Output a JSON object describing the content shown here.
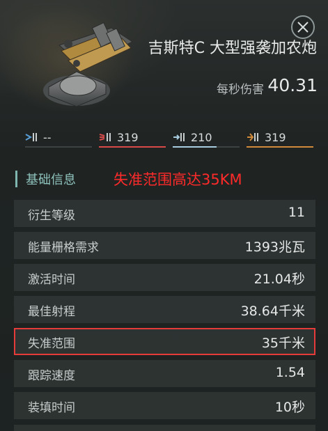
{
  "header": {
    "weapon_name": "吉斯特C 大型强袭加农炮",
    "dps_label": "每秒伤害",
    "dps_value": "40.31"
  },
  "damage": [
    {
      "name": "em",
      "icon": "em-damage-icon",
      "value": "--",
      "color": "#5aa0d8",
      "fill": 0
    },
    {
      "name": "thermal",
      "icon": "thermal-damage-icon",
      "value": "319",
      "color": "#d84a4a",
      "fill": 1.0
    },
    {
      "name": "kinetic",
      "icon": "kinetic-damage-icon",
      "value": "210",
      "color": "#a9cde0",
      "fill": 0.66
    },
    {
      "name": "explosive",
      "icon": "explosive-damage-icon",
      "value": "319",
      "color": "#d08a3a",
      "fill": 1.0
    }
  ],
  "section": {
    "title": "基础信息",
    "annotation": "失准范围高达35KM"
  },
  "stats": [
    {
      "label": "衍生等级",
      "value": "11",
      "highlight": false
    },
    {
      "label": "能量栅格需求",
      "value": "1393兆瓦",
      "highlight": false
    },
    {
      "label": "激活时间",
      "value": "21.04秒",
      "highlight": false
    },
    {
      "label": "最佳射程",
      "value": "38.64千米",
      "highlight": false
    },
    {
      "label": "失准范围",
      "value": "35千米",
      "highlight": true
    },
    {
      "label": "跟踪速度",
      "value": "1.54",
      "highlight": false
    },
    {
      "label": "装填时间",
      "value": "10秒",
      "highlight": false
    }
  ],
  "colors": {
    "accent": "#8fc3bd",
    "highlight": "#e53b3b",
    "annotation": "#ff2a2a"
  }
}
